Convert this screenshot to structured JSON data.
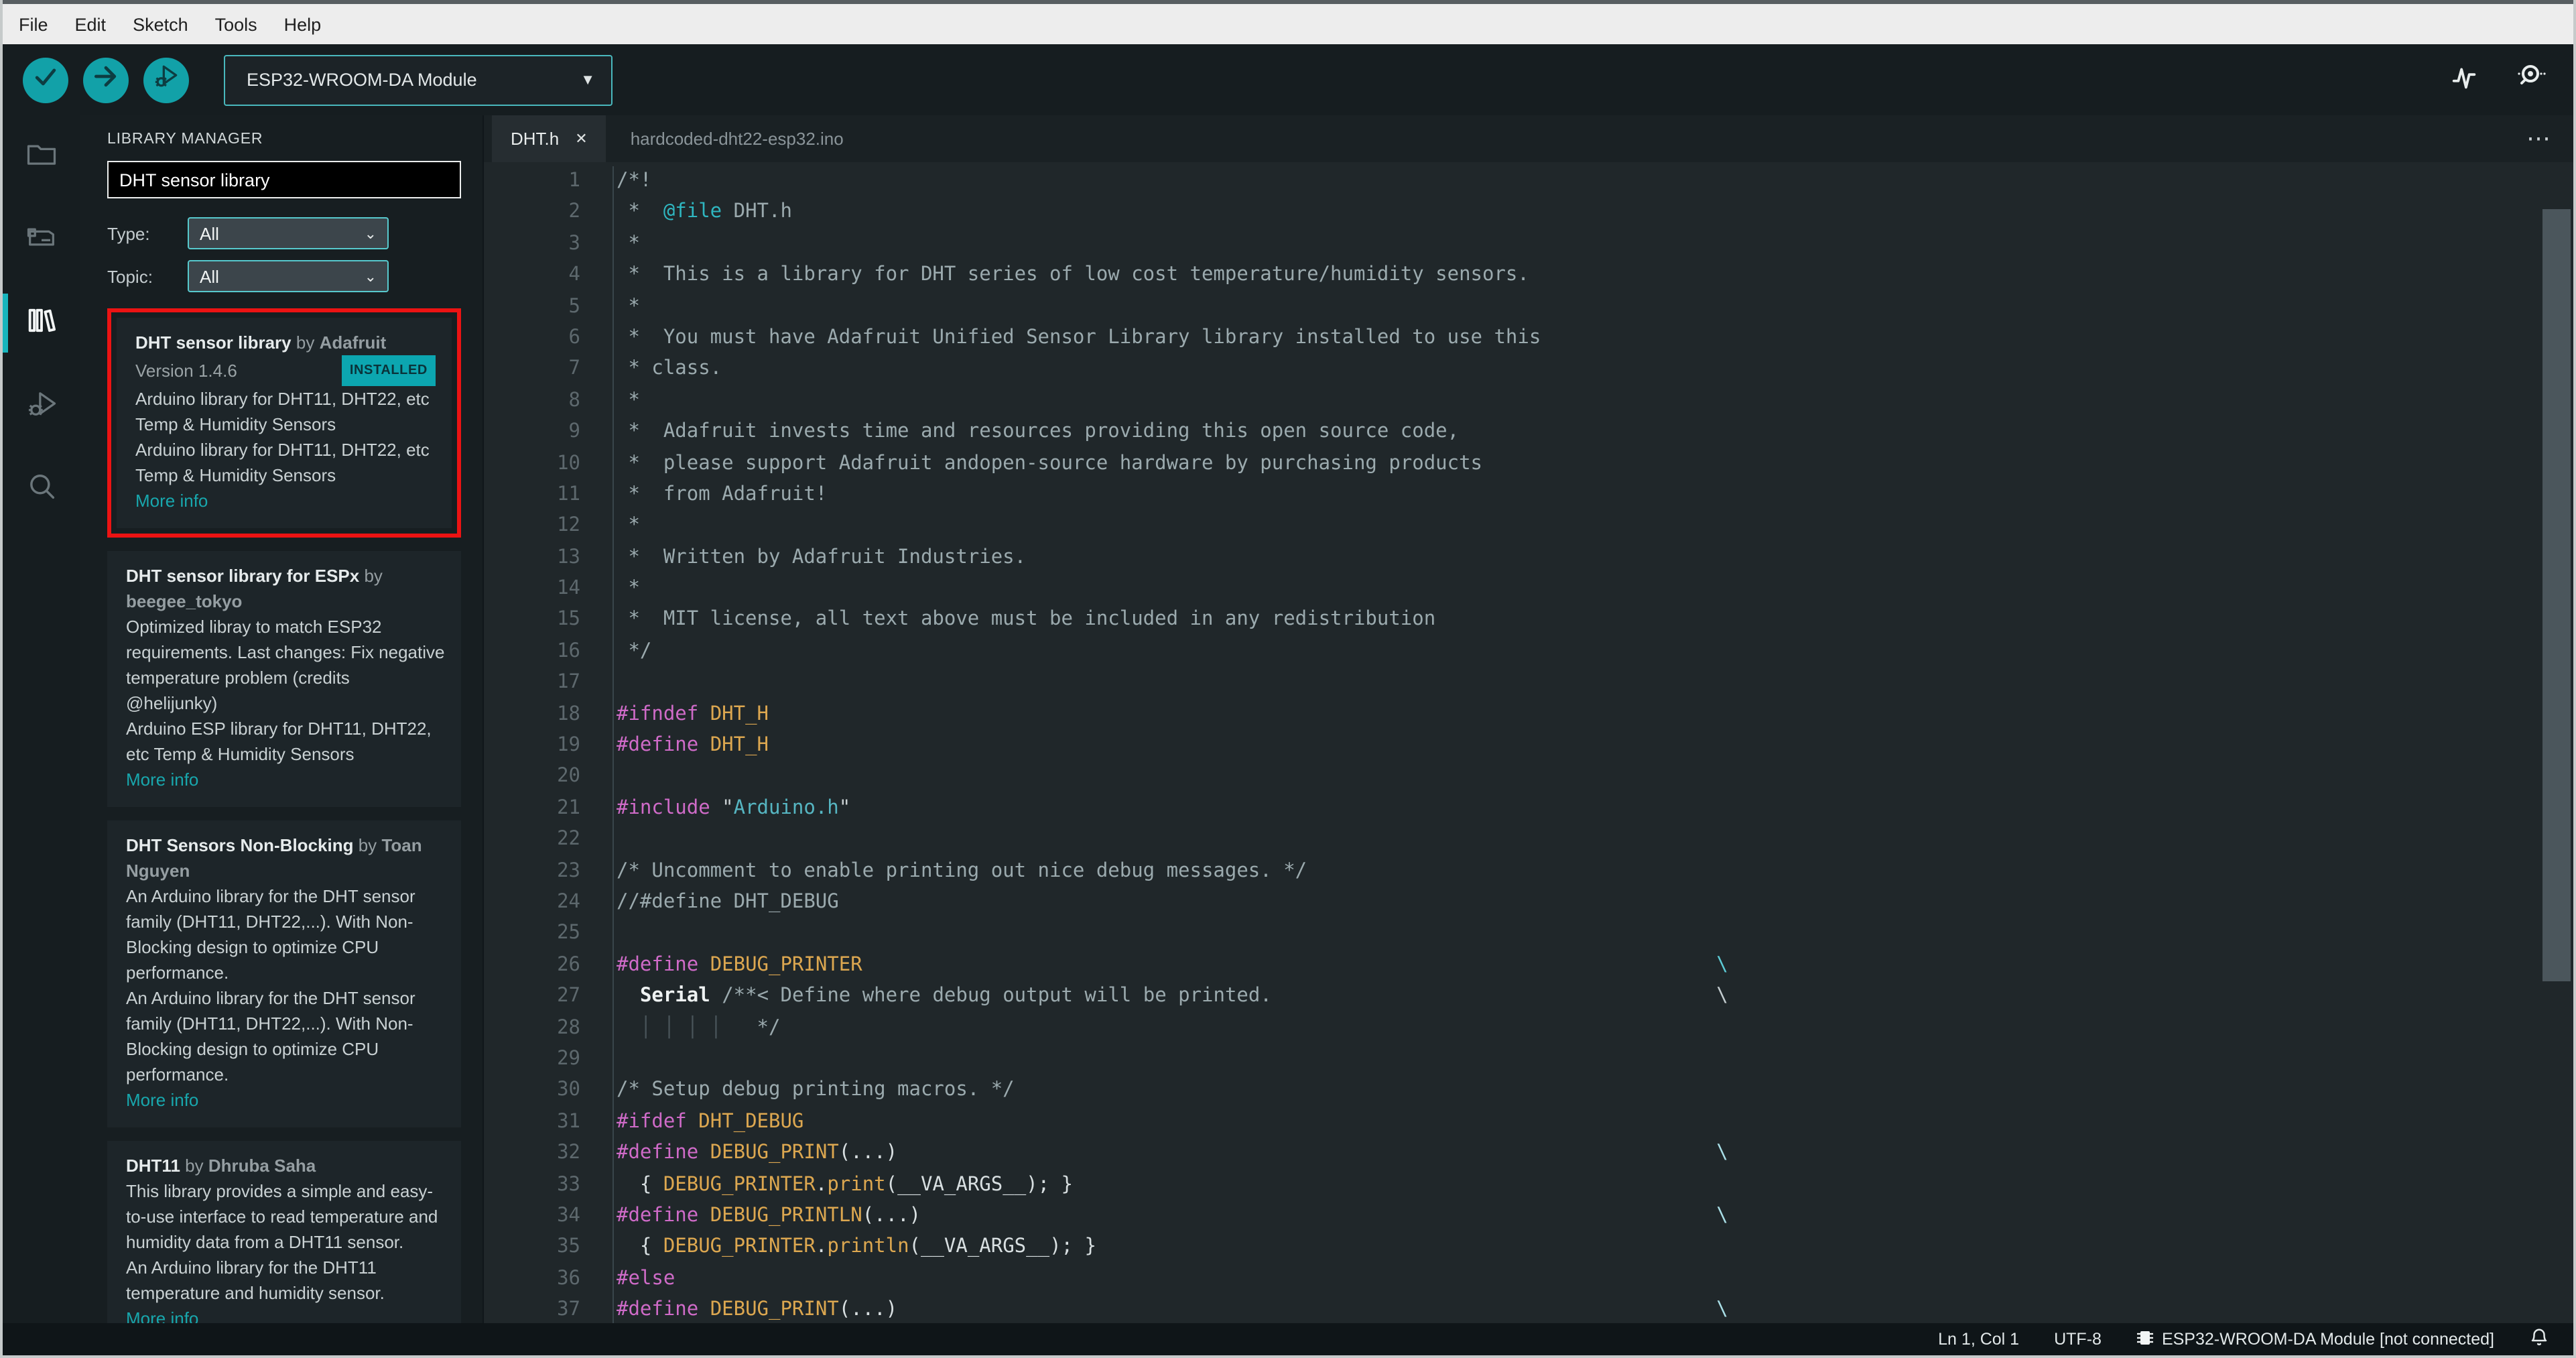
{
  "colors": {
    "accent_teal": "#12a1a8",
    "highlight_red": "#ec1313",
    "installed_badge": "#0ca6b0"
  },
  "menubar": {
    "items": [
      "File",
      "Edit",
      "Sketch",
      "Tools",
      "Help"
    ]
  },
  "toolbar": {
    "board_selector": "ESP32-WROOM-DA Module",
    "buttons": [
      "verify",
      "upload",
      "start-debugging"
    ],
    "right_icons": [
      "serial-plotter",
      "serial-monitor"
    ]
  },
  "sidebar_rail": {
    "items": [
      "sketchbook",
      "boards-manager",
      "library-manager",
      "debug",
      "search"
    ],
    "active": "library-manager"
  },
  "library": {
    "header": "LIBRARY MANAGER",
    "search_value": "DHT sensor library",
    "filters": [
      {
        "label": "Type:",
        "value": "All"
      },
      {
        "label": "Topic:",
        "value": "All"
      }
    ],
    "entries": [
      {
        "highlighted": true,
        "title": "DHT sensor library",
        "by": "by",
        "author": "Adafruit",
        "version": "Version 1.4.6",
        "badge": "INSTALLED",
        "desc": [
          "Arduino library for DHT11, DHT22, etc Temp & Humidity Sensors",
          "Arduino library for DHT11, DHT22, etc Temp & Humidity Sensors"
        ],
        "more": "More info"
      },
      {
        "highlighted": false,
        "title": "DHT sensor library for ESPx",
        "by": "by",
        "author": "beegee_tokyo",
        "desc": [
          "Optimized libray to match ESP32 requirements. Last changes: Fix negative temperature problem (credits @helijunky)",
          "Arduino ESP library for DHT11, DHT22, etc Temp & Humidity Sensors"
        ],
        "more": "More info"
      },
      {
        "highlighted": false,
        "title": "DHT Sensors Non-Blocking",
        "by": "by",
        "author": "Toan Nguyen",
        "desc": [
          "An Arduino library for the DHT sensor family (DHT11, DHT22,...). With Non-Blocking design to optimize CPU performance.",
          "An Arduino library for the DHT sensor family (DHT11, DHT22,...). With Non-Blocking design to optimize CPU performance."
        ],
        "more": "More info"
      },
      {
        "highlighted": false,
        "title": "DHT11",
        "by": "by",
        "author": "Dhruba Saha",
        "desc": [
          "This library provides a simple and easy-to-use interface to read temperature and humidity data from a DHT11 sensor.",
          "An Arduino library for the DHT11 temperature and humidity sensor."
        ],
        "more": "More info"
      }
    ]
  },
  "editor": {
    "tabs": [
      {
        "label": "DHT.h",
        "active": true,
        "closable": true
      },
      {
        "label": "hardcoded-dht22-esp32.ino",
        "active": false,
        "closable": false
      }
    ],
    "overflow_menu": "⋯",
    "code_lines": [
      {
        "n": 1,
        "seg": [
          [
            "/*!",
            "c"
          ]
        ]
      },
      {
        "n": 2,
        "seg": [
          [
            " *  ",
            "c"
          ],
          [
            "@file",
            "t"
          ],
          [
            " DHT.h",
            "c"
          ]
        ]
      },
      {
        "n": 3,
        "seg": [
          [
            " *",
            "c"
          ]
        ]
      },
      {
        "n": 4,
        "seg": [
          [
            " *  This is a library for DHT series of low cost temperature/humidity sensors.",
            "c"
          ]
        ]
      },
      {
        "n": 5,
        "seg": [
          [
            " *",
            "c"
          ]
        ]
      },
      {
        "n": 6,
        "seg": [
          [
            " *  You must have Adafruit Unified Sensor Library library installed to use this",
            "c"
          ]
        ]
      },
      {
        "n": 7,
        "seg": [
          [
            " * class.",
            "c"
          ]
        ]
      },
      {
        "n": 8,
        "seg": [
          [
            " *",
            "c"
          ]
        ]
      },
      {
        "n": 9,
        "seg": [
          [
            " *  Adafruit invests time and resources providing this open source code,",
            "c"
          ]
        ]
      },
      {
        "n": 10,
        "seg": [
          [
            " *  please support Adafruit andopen-source hardware by purchasing products",
            "c"
          ]
        ]
      },
      {
        "n": 11,
        "seg": [
          [
            " *  from Adafruit!",
            "c"
          ]
        ]
      },
      {
        "n": 12,
        "seg": [
          [
            " *",
            "c"
          ]
        ]
      },
      {
        "n": 13,
        "seg": [
          [
            " *  Written by Adafruit Industries.",
            "c"
          ]
        ]
      },
      {
        "n": 14,
        "seg": [
          [
            " *",
            "c"
          ]
        ]
      },
      {
        "n": 15,
        "seg": [
          [
            " *  MIT license, all text above must be included in any redistribution",
            "c"
          ]
        ]
      },
      {
        "n": 16,
        "seg": [
          [
            " */",
            "c"
          ]
        ]
      },
      {
        "n": 17,
        "seg": []
      },
      {
        "n": 18,
        "seg": [
          [
            "#ifndef",
            "p"
          ],
          [
            " ",
            "w"
          ],
          [
            "DHT_H",
            "m"
          ]
        ]
      },
      {
        "n": 19,
        "seg": [
          [
            "#define",
            "p"
          ],
          [
            " ",
            "w"
          ],
          [
            "DHT_H",
            "m"
          ]
        ]
      },
      {
        "n": 20,
        "seg": []
      },
      {
        "n": 21,
        "seg": [
          [
            "#include",
            "p"
          ],
          [
            " ",
            "w"
          ],
          [
            "\"",
            "q"
          ],
          [
            "Arduino.h",
            "s"
          ],
          [
            "\"",
            "q"
          ]
        ]
      },
      {
        "n": 22,
        "seg": []
      },
      {
        "n": 23,
        "seg": [
          [
            "/* Uncomment to enable printing out nice debug messages. */",
            "c"
          ]
        ]
      },
      {
        "n": 24,
        "seg": [
          [
            "//#define DHT_DEBUG",
            "c"
          ]
        ]
      },
      {
        "n": 25,
        "seg": []
      },
      {
        "n": 26,
        "seg": [
          [
            "#define",
            "p"
          ],
          [
            " ",
            "w"
          ],
          [
            "DEBUG_PRINTER",
            "m"
          ],
          [
            "                                                                         ",
            "w"
          ],
          [
            "\\",
            "x"
          ]
        ]
      },
      {
        "n": 27,
        "seg": [
          [
            "  ",
            "w"
          ],
          [
            "Serial",
            "b"
          ],
          [
            " ",
            "w"
          ],
          [
            "/**< Define where debug output will be printed.",
            "c"
          ],
          [
            "                                      ",
            "w"
          ],
          [
            "\\",
            "y"
          ]
        ]
      },
      {
        "n": 28,
        "seg": [
          [
            "  ",
            "w"
          ],
          [
            "│ │ │ │",
            "g"
          ],
          [
            "   */",
            "c"
          ]
        ]
      },
      {
        "n": 29,
        "seg": []
      },
      {
        "n": 30,
        "seg": [
          [
            "/* Setup debug printing macros. */",
            "c"
          ]
        ]
      },
      {
        "n": 31,
        "seg": [
          [
            "#ifdef",
            "p"
          ],
          [
            " ",
            "w"
          ],
          [
            "DHT_DEBUG",
            "m"
          ]
        ]
      },
      {
        "n": 32,
        "seg": [
          [
            "#define",
            "p"
          ],
          [
            " ",
            "w"
          ],
          [
            "DEBUG_PRINT",
            "m"
          ],
          [
            "(...)",
            "w"
          ],
          [
            "                                                                      ",
            "w"
          ],
          [
            "\\",
            "z"
          ]
        ]
      },
      {
        "n": 33,
        "seg": [
          [
            "  { ",
            "w"
          ],
          [
            "DEBUG_PRINTER",
            "m"
          ],
          [
            ".",
            "w"
          ],
          [
            "print",
            "m"
          ],
          [
            "(",
            "w"
          ],
          [
            "__VA_ARGS__",
            "w"
          ],
          [
            "); }",
            "w"
          ]
        ]
      },
      {
        "n": 34,
        "seg": [
          [
            "#define",
            "p"
          ],
          [
            " ",
            "w"
          ],
          [
            "DEBUG_PRINTLN",
            "m"
          ],
          [
            "(...)",
            "w"
          ],
          [
            "                                                                    ",
            "w"
          ],
          [
            "\\",
            "z"
          ]
        ]
      },
      {
        "n": 35,
        "seg": [
          [
            "  { ",
            "w"
          ],
          [
            "DEBUG_PRINTER",
            "m"
          ],
          [
            ".",
            "w"
          ],
          [
            "println",
            "m"
          ],
          [
            "(",
            "w"
          ],
          [
            "__VA_ARGS__",
            "w"
          ],
          [
            "); }",
            "w"
          ]
        ]
      },
      {
        "n": 36,
        "seg": [
          [
            "#else",
            "p"
          ]
        ]
      },
      {
        "n": 37,
        "seg": [
          [
            "#define",
            "p"
          ],
          [
            " ",
            "w"
          ],
          [
            "DEBUG_PRINT",
            "m"
          ],
          [
            "(...)",
            "w"
          ],
          [
            "                                                                      ",
            "w"
          ],
          [
            "\\",
            "z"
          ]
        ]
      }
    ]
  },
  "statusbar": {
    "position": "Ln 1, Col 1",
    "encoding": "UTF-8",
    "board": "ESP32-WROOM-DA Module [not connected]"
  }
}
